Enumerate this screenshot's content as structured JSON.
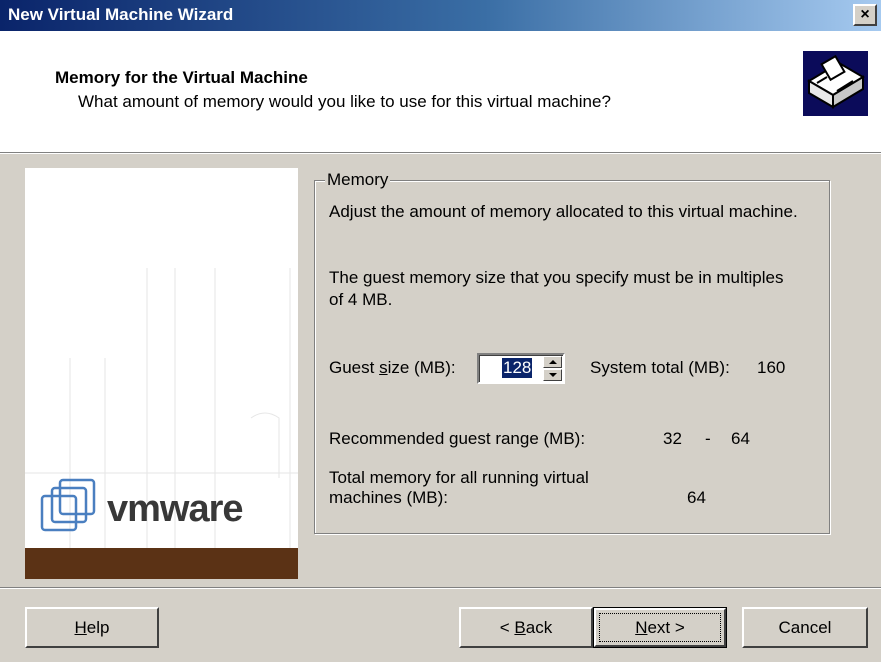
{
  "window": {
    "title": "New Virtual Machine Wizard",
    "close_glyph": "×"
  },
  "header": {
    "title": "Memory for the Virtual Machine",
    "subtitle": "What amount of memory would you like to use for this virtual machine?",
    "icon": "memory-card-icon"
  },
  "sidebar": {
    "logo_icon": "vmware-logo-icon",
    "wordmark": "vmware",
    "brand_color": "#5b3215"
  },
  "memory": {
    "group_label": "Memory",
    "description1": "Adjust the amount of memory allocated to this virtual machine.",
    "description2": "The guest memory size that you specify must be in multiples of 4 MB.",
    "guest_size_label_pre": "Guest ",
    "guest_size_label_ul": "s",
    "guest_size_label_post": "ize (MB):",
    "guest_size_value": "128",
    "system_total_label": "System total (MB):",
    "system_total_value": "160",
    "recommended_label": "Recommended guest range (MB):",
    "recommended_min": "32",
    "recommended_sep": "-",
    "recommended_max": "64",
    "total_running_label": "Total memory for all running virtual machines (MB):",
    "total_running_value": "64"
  },
  "buttons": {
    "help_ul": "H",
    "help_rest": "elp",
    "back_pre": "< ",
    "back_ul": "B",
    "back_rest": "ack",
    "next_ul": "N",
    "next_rest": "ext >",
    "cancel": "Cancel"
  },
  "colors": {
    "titlebar_start": "#0a246a",
    "titlebar_end": "#a6caf0",
    "selection": "#0a246a",
    "dialog_bg": "#d4d0c8"
  }
}
